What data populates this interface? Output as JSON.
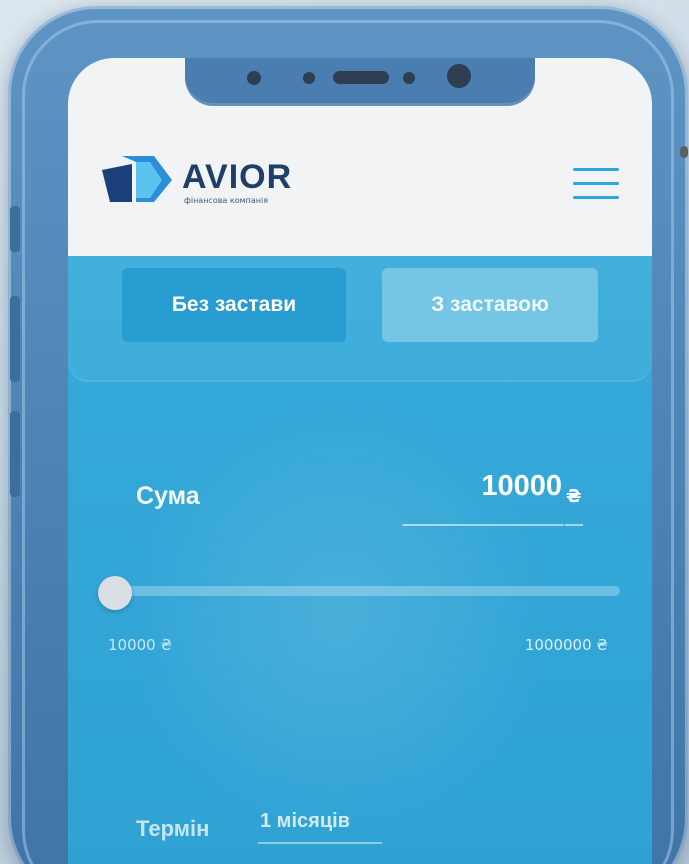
{
  "header": {
    "logo_name": "AVIOR",
    "logo_subtitle": "фінансова компанія",
    "menu_icon": "hamburger-menu-icon"
  },
  "tabs": [
    {
      "label": "Без застави",
      "selected": true
    },
    {
      "label": "З заставою",
      "selected": false
    }
  ],
  "form": {
    "sum_label": "Сума",
    "sum_value": "10000",
    "currency": "₴",
    "slider_progress": 0,
    "range_min": "10000 ₴",
    "range_max": "1000000 ₴",
    "term_label": "Термін",
    "term_value": "1 місяців"
  },
  "colors": {
    "accent": "#2aa6e0",
    "logo": "#1e3f66",
    "screen_bg": "#34a8d8"
  }
}
